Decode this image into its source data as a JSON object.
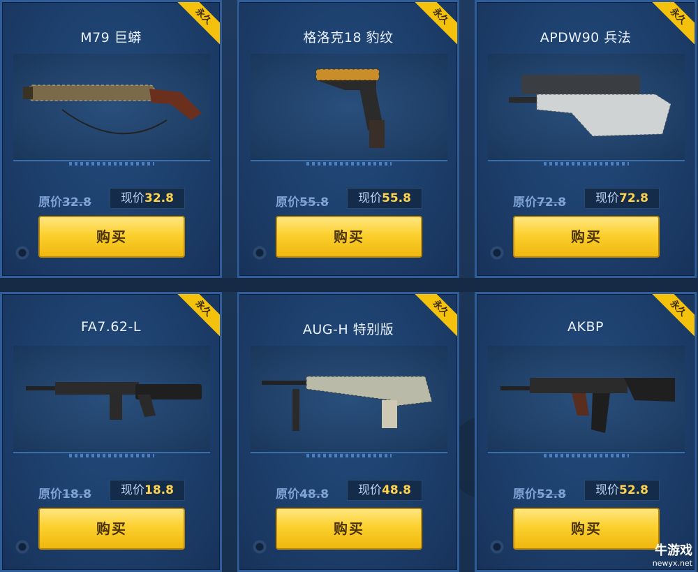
{
  "badge": "永久",
  "buy_label": "购买",
  "orig_prefix": "原价",
  "now_prefix": "现价",
  "items": [
    {
      "name": "M79 巨蟒",
      "orig": "32.8",
      "now": "32.8"
    },
    {
      "name": "格洛克18 豹纹",
      "orig": "55.8",
      "now": "55.8"
    },
    {
      "name": "APDW90 兵法",
      "orig": "72.8",
      "now": "72.8"
    },
    {
      "name": "FA7.62-L",
      "orig": "18.8",
      "now": "18.8"
    },
    {
      "name": "AUG-H 特别版",
      "orig": "48.8",
      "now": "48.8"
    },
    {
      "name": "AKBP",
      "orig": "52.8",
      "now": "52.8"
    }
  ],
  "watermark": {
    "brand": "牛游戏",
    "url": "newyx.net"
  },
  "colors": {
    "accent": "#f4c20d",
    "price": "#ffd34a",
    "frame": "#2f5d9a"
  }
}
